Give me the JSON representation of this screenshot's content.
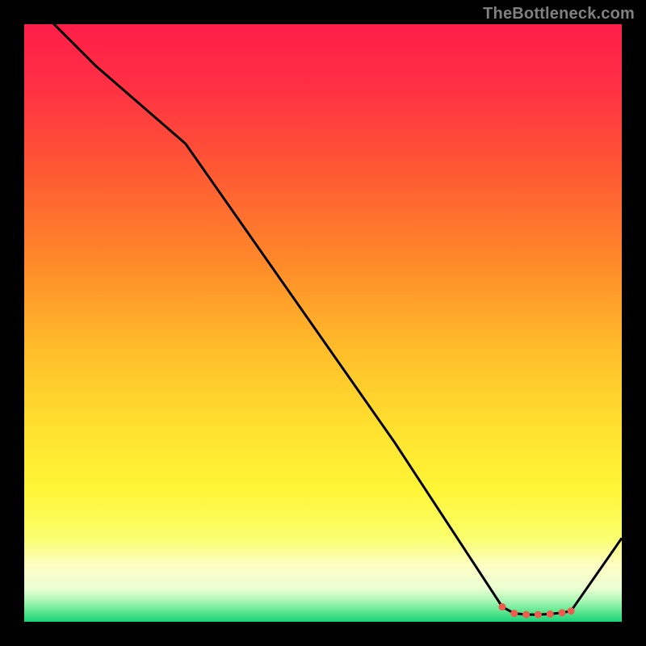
{
  "watermark": "TheBottleneck.com",
  "colors": {
    "frame": "#000000",
    "line": "#000000",
    "marker": "#ef5c4e"
  },
  "gradient_stops": [
    {
      "offset": 0,
      "color": "#ff1e49"
    },
    {
      "offset": 0.1,
      "color": "#ff2f44"
    },
    {
      "offset": 0.25,
      "color": "#ff5a33"
    },
    {
      "offset": 0.4,
      "color": "#ff8a29"
    },
    {
      "offset": 0.55,
      "color": "#ffbf2a"
    },
    {
      "offset": 0.68,
      "color": "#ffe22f"
    },
    {
      "offset": 0.78,
      "color": "#fff637"
    },
    {
      "offset": 0.86,
      "color": "#faff6d"
    },
    {
      "offset": 0.905,
      "color": "#feffc3"
    },
    {
      "offset": 0.945,
      "color": "#e9ffd2"
    },
    {
      "offset": 0.965,
      "color": "#a9f7b4"
    },
    {
      "offset": 0.985,
      "color": "#55e48c"
    },
    {
      "offset": 1.0,
      "color": "#18d27a"
    }
  ],
  "chart_data": {
    "type": "line",
    "title": "",
    "xlabel": "",
    "ylabel": "",
    "xlim": [
      0,
      100
    ],
    "ylim": [
      0,
      100
    ],
    "series": [
      {
        "name": "curve",
        "x": [
          0,
          12,
          27,
          62,
          80,
          82,
          84,
          86,
          88,
          90,
          91.5,
          100
        ],
        "y": [
          105,
          93,
          80,
          30,
          2.5,
          1.4,
          1.2,
          1.2,
          1.3,
          1.5,
          1.8,
          14
        ]
      }
    ],
    "markers": {
      "name": "flat-section",
      "x": [
        80,
        82,
        84,
        86,
        88,
        90,
        91.5
      ],
      "y": [
        2.5,
        1.4,
        1.2,
        1.2,
        1.3,
        1.5,
        1.8
      ]
    }
  }
}
